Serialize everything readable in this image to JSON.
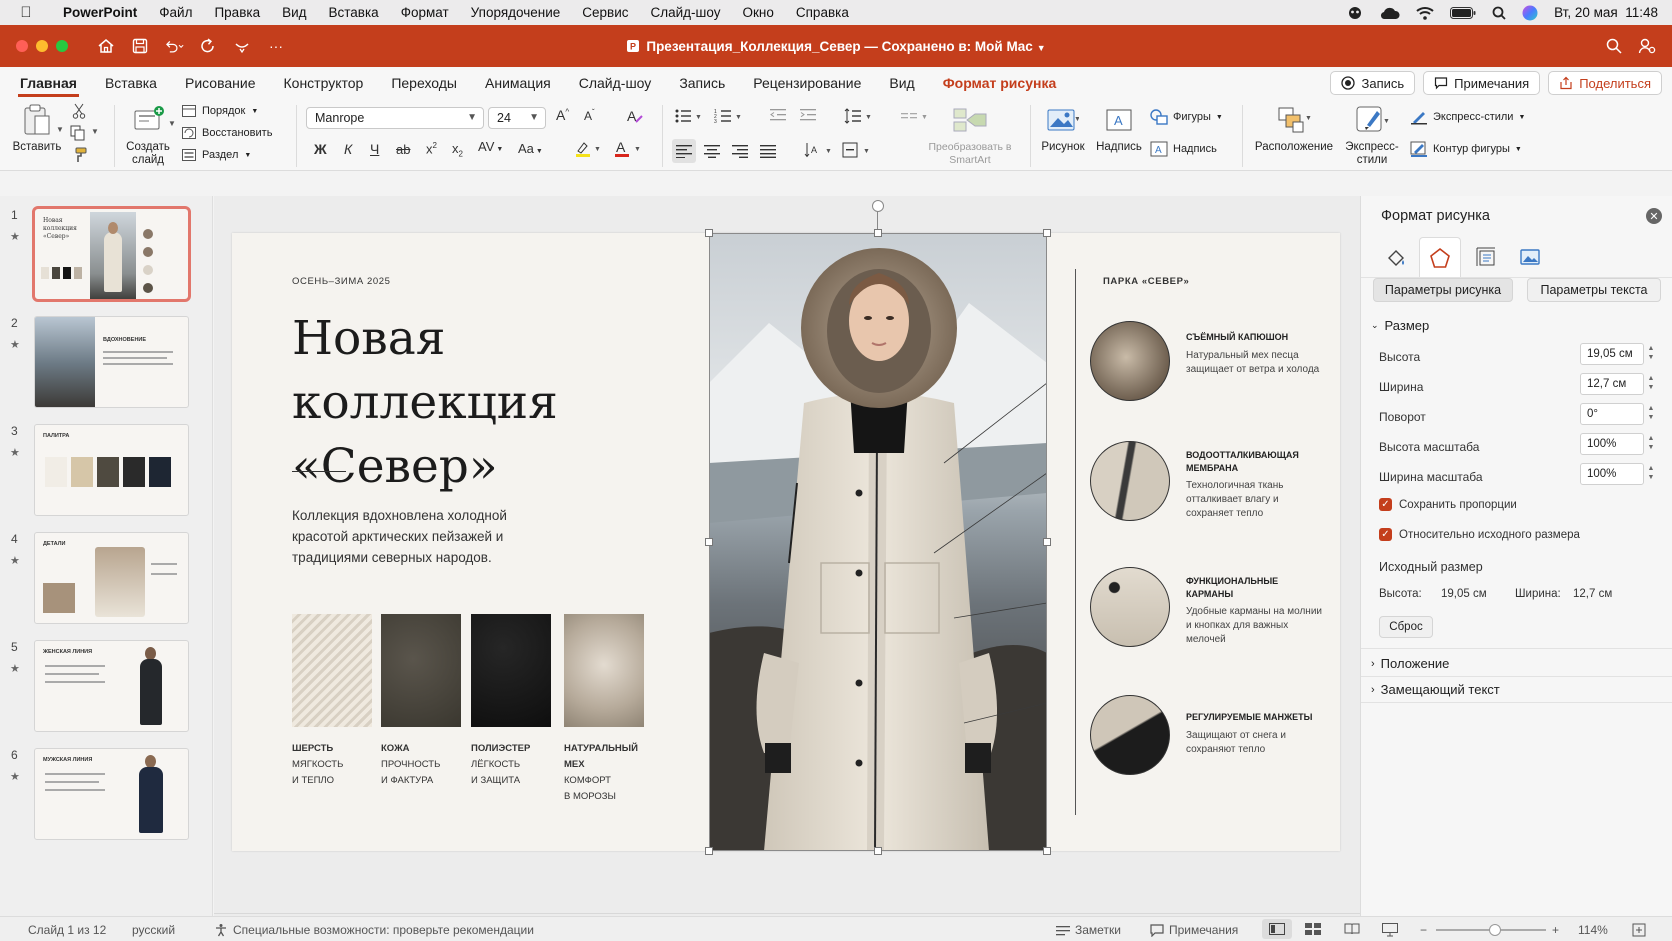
{
  "menubar": {
    "app": "PowerPoint",
    "items": [
      "Файл",
      "Правка",
      "Вид",
      "Вставка",
      "Формат",
      "Упорядочение",
      "Сервис",
      "Слайд-шоу",
      "Окно",
      "Справка"
    ],
    "datetime": "Вт, 20 мая  11:48"
  },
  "window": {
    "title": "Презентация_Коллекция_Север — Сохранено в: Мой Mac",
    "accent": "#c43e1c"
  },
  "ribbon_tabs": [
    "Главная",
    "Вставка",
    "Рисование",
    "Конструктор",
    "Переходы",
    "Анимация",
    "Слайд-шоу",
    "Запись",
    "Рецензирование",
    "Вид",
    "Формат рисунка"
  ],
  "tab_buttons": {
    "record": "Запись",
    "comments": "Примечания",
    "share": "Поделиться"
  },
  "ribbon": {
    "paste": "Вставить",
    "new_slide_1": "Создать",
    "new_slide_2": "слайд",
    "layout": "Порядок",
    "reset": "Восстановить",
    "section": "Раздел",
    "font": "Manrope",
    "font_size": "24",
    "bold": "Ж",
    "italic": "К",
    "underline": "Ч",
    "case": "Aa",
    "smartart_1": "Преобразовать в",
    "smartart_2": "SmartArt",
    "picture": "Рисунок",
    "textbox": "Надпись",
    "shapes": "Фигуры",
    "caption": "Надпись",
    "arrange": "Расположение",
    "quick_styles_1": "Экспресс-",
    "quick_styles_2": "стили",
    "express_styles": "Экспресс-стили",
    "shape_outline": "Контур фигуры"
  },
  "thumbnails": [
    {
      "num": "1",
      "title": "Новая коллекция «Север»"
    },
    {
      "num": "2",
      "title": "ВДОХНОВЕНИЕ"
    },
    {
      "num": "3",
      "title": "ПАЛИТРА"
    },
    {
      "num": "4",
      "title": "ДЕТАЛИ"
    },
    {
      "num": "5",
      "title": "ЖЕНСКАЯ ЛИНИЯ"
    },
    {
      "num": "6",
      "title": "МУЖСКАЯ ЛИНИЯ"
    }
  ],
  "slide": {
    "season": "ОСЕНЬ–ЗИМА 2025",
    "title_line1": "Новая коллекция",
    "title_line2": "«Север»",
    "description": "Коллекция вдохновлена холодной красотой арктических пейзажей и традициями северных народов.",
    "materials": [
      {
        "name": "ШЕРСТЬ",
        "line1": "МЯГКОСТЬ",
        "line2": "И ТЕПЛО",
        "color": "#e6e0d6"
      },
      {
        "name": "КОЖА",
        "line1": "ПРОЧНОСТЬ",
        "line2": "И ФАКТУРА",
        "color": "#4a463e"
      },
      {
        "name": "ПОЛИЭСТЕР",
        "line1": "ЛЁГКОСТЬ",
        "line2": "И ЗАЩИТА",
        "color": "#141414"
      },
      {
        "name": "НАТУРАЛЬНЫЙ",
        "name2": "МЕХ",
        "line1": "КОМФОРТ",
        "line2": "В МОРОЗЫ",
        "color": "#bdb2a4"
      }
    ],
    "parka_label": "ПАРКА «СЕВЕР»",
    "details": [
      {
        "title": "СЪЁМНЫЙ КАПЮШОН",
        "desc": "Натуральный мех песца защищает от ветра и холода"
      },
      {
        "title": "ВОДООТТАЛКИВАЮЩАЯ МЕМБРАНА",
        "desc": "Технологичная ткань отталкивает влагу и сохраняет тепло"
      },
      {
        "title": "ФУНКЦИОНАЛЬНЫЕ КАРМАНЫ",
        "desc": "Удобные карманы на молнии и кнопках для важных мелочей"
      },
      {
        "title": "РЕГУЛИРУЕМЫЕ МАНЖЕТЫ",
        "desc": "Защищают от снега и сохраняют тепло"
      }
    ]
  },
  "pane": {
    "title": "Формат рисунка",
    "tab_picture": "Параметры рисунка",
    "tab_text": "Параметры текста",
    "size_section": "Размер",
    "height_label": "Высота",
    "height_value": "19,05 см",
    "width_label": "Ширина",
    "width_value": "12,7 см",
    "rotation_label": "Поворот",
    "rotation_value": "0°",
    "scale_height_label": "Высота масштаба",
    "scale_height_value": "100%",
    "scale_width_label": "Ширина масштаба",
    "scale_width_value": "100%",
    "lock_aspect": "Сохранить пропорции",
    "relative_original": "Относительно исходного размера",
    "original_size": "Исходный размер",
    "orig_height_label": "Высота:",
    "orig_height": "19,05 см",
    "orig_width_label": "Ширина:",
    "orig_width": "12,7 см",
    "reset": "Сброс",
    "position_section": "Положение",
    "alt_text_section": "Замещающий текст"
  },
  "statusbar": {
    "slide_counter": "Слайд 1 из 12",
    "language": "русский",
    "accessibility": "Специальные возможности: проверьте рекомендации",
    "notes": "Заметки",
    "comments": "Примечания",
    "zoom": "114%"
  }
}
